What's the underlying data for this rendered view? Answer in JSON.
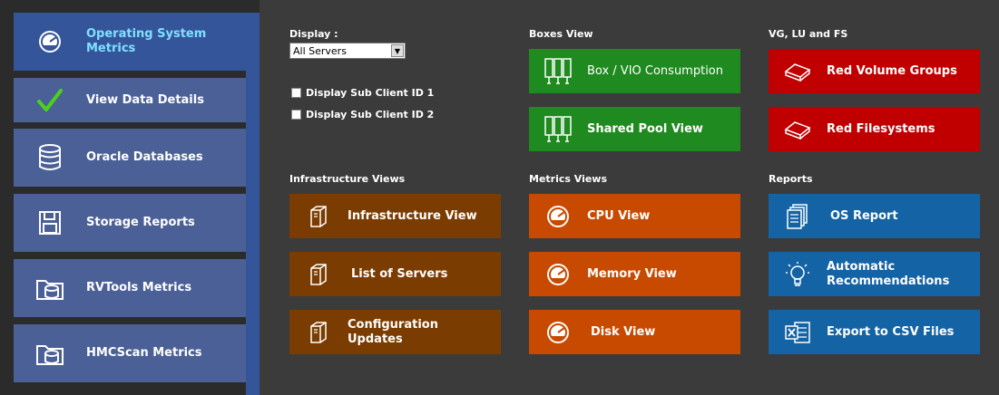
{
  "sidebar": {
    "items": [
      {
        "label": "Operating System Metrics",
        "icon": "gauge-icon"
      },
      {
        "label": "View Data Details",
        "icon": "checkmark-icon"
      },
      {
        "label": "Oracle Databases",
        "icon": "database-icon"
      },
      {
        "label": "Storage Reports",
        "icon": "floppy-disk-icon"
      },
      {
        "label": "RVTools Metrics",
        "icon": "folder-database-icon"
      },
      {
        "label": "HMCScan Metrics",
        "icon": "folder-database-icon"
      }
    ]
  },
  "display": {
    "label": "Display :",
    "selected": "All Servers",
    "subclient1": "Display Sub Client ID 1",
    "subclient2": "Display Sub Client ID 2"
  },
  "boxes": {
    "title": "Boxes View",
    "box_vio": "Box / VIO Consumption",
    "shared_pool": "Shared Pool View"
  },
  "vg": {
    "title": "VG, LU and FS",
    "red_vg": "Red Volume Groups",
    "red_fs": "Red Filesystems"
  },
  "infra": {
    "title": "Infrastructure Views",
    "infra_view": "Infrastructure View",
    "list_servers": "List of Servers",
    "config_updates": "Configuration Updates"
  },
  "metrics": {
    "title": "Metrics Views",
    "cpu": "CPU View",
    "memory": "Memory View",
    "disk": "Disk View"
  },
  "reports": {
    "title": "Reports",
    "os_report": "OS Report",
    "auto_reco": "Automatic Recommendations",
    "export_csv": "Export to CSV Files"
  },
  "colors": {
    "sidebar_active": "#35559a",
    "sidebar_button": "#4a6096",
    "green": "#1f8a1f",
    "red": "#c00000",
    "brown": "#7a3c00",
    "orange": "#c84a00",
    "blue": "#1363a5"
  }
}
